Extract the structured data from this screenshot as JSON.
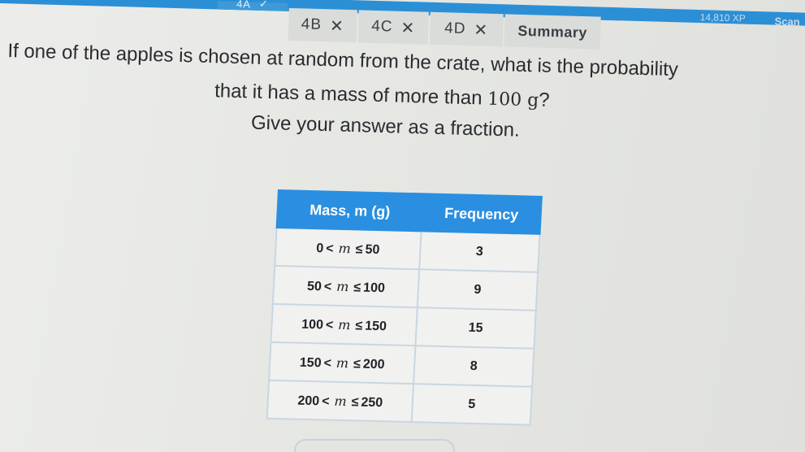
{
  "tabs": [
    {
      "label": "4A",
      "mark": "✓",
      "state": "active"
    },
    {
      "label": "4B",
      "mark": "✕",
      "state": "wrong"
    },
    {
      "label": "4C",
      "mark": "✕",
      "state": "wrong"
    },
    {
      "label": "4D",
      "mark": "✕",
      "state": "wrong"
    },
    {
      "label": "Summary",
      "mark": "",
      "state": "summary"
    }
  ],
  "header": {
    "xp": "14,810 XP",
    "scan": "Scan"
  },
  "question": {
    "line1": "If one of the apples is chosen at random from the crate, what is the probability",
    "line2_text": "that it has a mass of more than ",
    "line2_value": "100 g",
    "line2_end": "?",
    "line3": "Give your answer as a fraction."
  },
  "table": {
    "headers": {
      "mass": "Mass, m (g)",
      "frequency": "Frequency"
    },
    "rows": [
      {
        "lower": "0",
        "upper": "50",
        "frequency": "3"
      },
      {
        "lower": "50",
        "upper": "100",
        "frequency": "9"
      },
      {
        "lower": "100",
        "upper": "150",
        "frequency": "15"
      },
      {
        "lower": "150",
        "upper": "200",
        "frequency": "8"
      },
      {
        "lower": "200",
        "upper": "250",
        "frequency": "5"
      }
    ],
    "variable": "m",
    "op_lt": "<",
    "op_le": "≤"
  },
  "colors": {
    "accent": "#2a8fe0",
    "tab_bg": "#dadcd9"
  }
}
